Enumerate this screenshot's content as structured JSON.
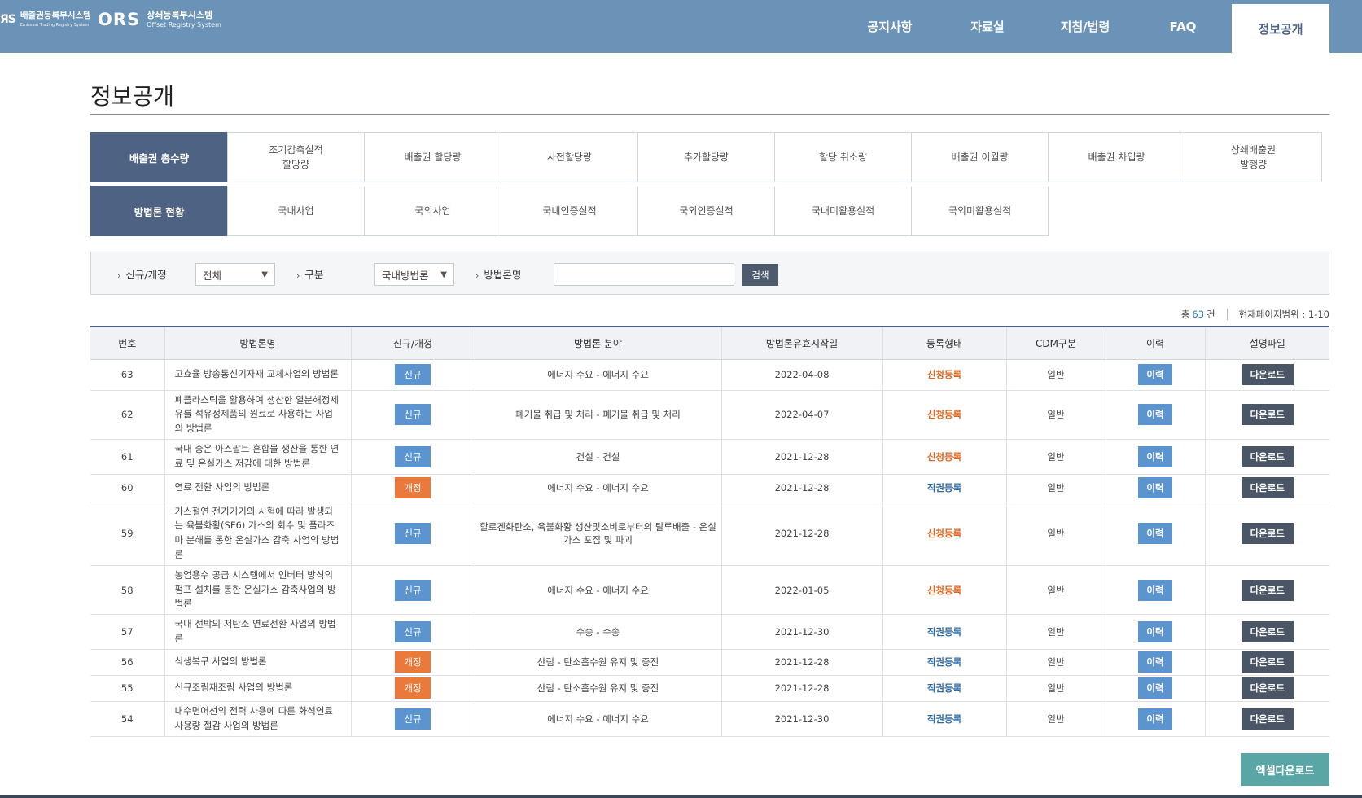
{
  "header": {
    "logo1": {
      "mark": "ЯS",
      "ko": "배출권등록부시스템",
      "en": "Emission Trading Registry System"
    },
    "logo2": {
      "mark": "ORS",
      "ko": "상쇄등록부시스템",
      "en": "Offset Registry System"
    },
    "nav": [
      {
        "label": "공지사항",
        "active": false
      },
      {
        "label": "자료실",
        "active": false
      },
      {
        "label": "지침/법령",
        "active": false
      },
      {
        "label": "FAQ",
        "active": false
      },
      {
        "label": "정보공개",
        "active": true
      }
    ]
  },
  "page_title": "정보공개",
  "tabs": {
    "row1": {
      "head": "배출권 총수량",
      "items": [
        "조기감축실적\n할당량",
        "배출권 할당량",
        "사전할당량",
        "추가할당량",
        "할당 취소량",
        "배출권 이월량",
        "배출권 차입량",
        "상쇄배출권\n발행량"
      ]
    },
    "row2": {
      "head": "방법론 현황",
      "items": [
        "국내사업",
        "국외사업",
        "국내인증실적",
        "국외인증실적",
        "국내미활용실적",
        "국외미활용실적"
      ]
    }
  },
  "search": {
    "label_type": "신규/개정",
    "type_value": "전체",
    "label_category": "구분",
    "category_value": "국내방법론",
    "label_name": "방법론명",
    "name_value": "",
    "button": "검색"
  },
  "count": {
    "prefix": "총",
    "total": "63",
    "suffix": "건",
    "range": "현재페이지범위 : 1-10"
  },
  "table": {
    "headers": [
      "번호",
      "방법론명",
      "신규/개정",
      "방법론 분야",
      "방법론유효시작일",
      "등록형태",
      "CDM구분",
      "이력",
      "설명파일"
    ],
    "rows": [
      {
        "no": "63",
        "name": "고효율 방송통신기자재 교체사업의 방법론",
        "type": "신규",
        "field": "에너지 수요 - 에너지 수요",
        "date": "2022-04-08",
        "reg": "신청등록",
        "cdm": "일반",
        "hist": "이력",
        "file": "다운로드"
      },
      {
        "no": "62",
        "name": "폐플라스틱을 활용하여 생산한 열분해정제유를 석유정제품의 원료로 사용하는 사업의 방법론",
        "type": "신규",
        "field": "폐기물 취급 및 처리 - 폐기물 취급 및 처리",
        "date": "2022-04-07",
        "reg": "신청등록",
        "cdm": "일반",
        "hist": "이력",
        "file": "다운로드"
      },
      {
        "no": "61",
        "name": "국내 중온 아스팔트 혼합물 생산을 통한 연료 및 온실가스 저감에 대한 방법론",
        "type": "신규",
        "field": "건설 - 건설",
        "date": "2021-12-28",
        "reg": "신청등록",
        "cdm": "일반",
        "hist": "이력",
        "file": "다운로드"
      },
      {
        "no": "60",
        "name": "연료 전환 사업의 방법론",
        "type": "개정",
        "field": "에너지 수요 - 에너지 수요",
        "date": "2021-12-28",
        "reg": "직권등록",
        "cdm": "일반",
        "hist": "이력",
        "file": "다운로드"
      },
      {
        "no": "59",
        "name": "가스절연 전기기기의 시험에 따라 발생되는 육불화황(SF6) 가스의 회수 및 플라즈마 분해를 통한 온실가스 감축 사업의 방법론",
        "type": "신규",
        "field": "할로겐화탄소, 육불화황 생산및소비로부터의 탈루배출 - 온실가스 포집 및 파괴",
        "date": "2021-12-28",
        "reg": "신청등록",
        "cdm": "일반",
        "hist": "이력",
        "file": "다운로드"
      },
      {
        "no": "58",
        "name": "농업용수 공급 시스템에서 인버터 방식의 펌프 설치를 통한 온실가스 감축사업의 방법론",
        "type": "신규",
        "field": "에너지 수요 - 에너지 수요",
        "date": "2022-01-05",
        "reg": "신청등록",
        "cdm": "일반",
        "hist": "이력",
        "file": "다운로드"
      },
      {
        "no": "57",
        "name": "국내 선박의 저탄소 연료전환 사업의 방법론",
        "type": "신규",
        "field": "수송 - 수송",
        "date": "2021-12-30",
        "reg": "직권등록",
        "cdm": "일반",
        "hist": "이력",
        "file": "다운로드"
      },
      {
        "no": "56",
        "name": "식생복구 사업의 방법론",
        "type": "개정",
        "field": "산림 - 탄소흡수원 유지 및 증진",
        "date": "2021-12-28",
        "reg": "직권등록",
        "cdm": "일반",
        "hist": "이력",
        "file": "다운로드"
      },
      {
        "no": "55",
        "name": "신규조림재조림 사업의 방법론",
        "type": "개정",
        "field": "산림 - 탄소흡수원 유지 및 증진",
        "date": "2021-12-28",
        "reg": "직권등록",
        "cdm": "일반",
        "hist": "이력",
        "file": "다운로드"
      },
      {
        "no": "54",
        "name": "내수면어선의 전력 사용에 따른 화석연료 사용량 절감 사업의 방법론",
        "type": "신규",
        "field": "에너지 수요 - 에너지 수요",
        "date": "2021-12-30",
        "reg": "직권등록",
        "cdm": "일반",
        "hist": "이력",
        "file": "다운로드"
      }
    ]
  },
  "excel_button": "엑셀다운로드",
  "colors": {
    "header_bg": "#6b93b8",
    "tab_head_bg": "#4e6383",
    "badge_new": "#5b94cf",
    "badge_revised": "#ea7a3c",
    "reg_apply": "#e0651d",
    "reg_authority": "#2e6ca8",
    "download_btn": "#4a5566",
    "excel_btn": "#5aa6a6"
  }
}
